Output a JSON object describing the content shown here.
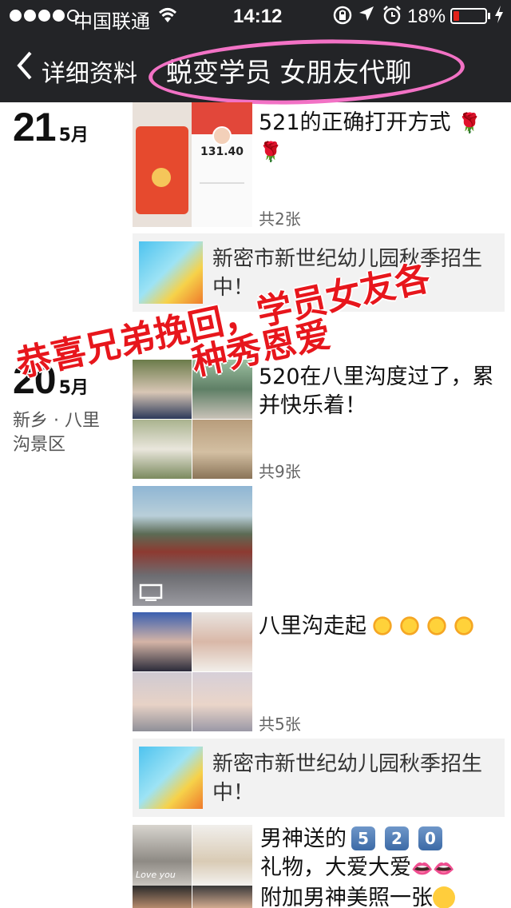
{
  "status_bar": {
    "carrier": "中国联通",
    "time": "14:12",
    "battery_percent": "18%",
    "battery_level": 0.18,
    "icons": [
      "signal-dots",
      "wifi-icon",
      "rotation-lock-icon",
      "location-icon",
      "alarm-icon",
      "battery-icon",
      "charging-bolt-icon"
    ]
  },
  "nav": {
    "back_label": "详细资料",
    "title": "蜕变学员 女朋友代聊",
    "highlight_color": "#f272c5"
  },
  "feed": [
    {
      "day": "21",
      "month": "5月",
      "location": "",
      "posts": [
        {
          "text": "521的正确打开方式",
          "emoji": [
            "rose",
            "rose"
          ],
          "count": "共2张",
          "screenshot_amount": "131.40"
        },
        {
          "type": "share",
          "text": "新密市新世纪幼儿园秋季招生中！"
        }
      ]
    },
    {
      "day": "20",
      "month": "5月",
      "location": "新乡 · 八里沟景区",
      "posts": [
        {
          "text": "520在八里沟度过了，累并快乐着！",
          "count": "共9张"
        },
        {
          "type": "video"
        },
        {
          "text": "八里沟走起",
          "emoji": [
            "sun",
            "sun",
            "sun",
            "sun"
          ],
          "count": "共5张"
        },
        {
          "type": "share",
          "text": "新密市新世纪幼儿园秋季招生中！"
        },
        {
          "text_a": "男神送的",
          "keycaps": [
            "5",
            "2",
            "0"
          ],
          "text_b": "礼物，大爱大爱",
          "text_c": "附加男神美照一张",
          "thumb_text": "Love you"
        }
      ]
    }
  ],
  "overlay": {
    "line1": "恭喜兄弟挽回，学员女友各",
    "line2": "种秀恩爱",
    "color": "#e7161c"
  }
}
